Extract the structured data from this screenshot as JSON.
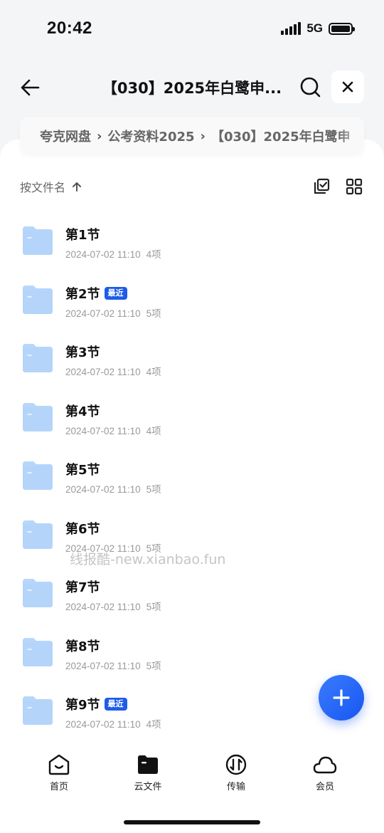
{
  "status_bar": {
    "time": "20:42",
    "network": "5G"
  },
  "nav": {
    "title": "【030】2025年白鹭申..."
  },
  "breadcrumb": {
    "items": [
      "夸克网盘",
      "公考资料2025",
      "【030】2025年白鹭申"
    ]
  },
  "sort": {
    "label": "按文件名"
  },
  "files": [
    {
      "name": "第1节",
      "date": "2024-07-02 11:10",
      "count": "4项",
      "badge": ""
    },
    {
      "name": "第2节",
      "date": "2024-07-02 11:10",
      "count": "5项",
      "badge": "最近"
    },
    {
      "name": "第3节",
      "date": "2024-07-02 11:10",
      "count": "4项",
      "badge": ""
    },
    {
      "name": "第4节",
      "date": "2024-07-02 11:10",
      "count": "4项",
      "badge": ""
    },
    {
      "name": "第5节",
      "date": "2024-07-02 11:10",
      "count": "5项",
      "badge": ""
    },
    {
      "name": "第6节",
      "date": "2024-07-02 11:10",
      "count": "5项",
      "badge": ""
    },
    {
      "name": "第7节",
      "date": "2024-07-02 11:10",
      "count": "5项",
      "badge": ""
    },
    {
      "name": "第8节",
      "date": "2024-07-02 11:10",
      "count": "5项",
      "badge": ""
    },
    {
      "name": "第9节",
      "date": "2024-07-02 11:10",
      "count": "4项",
      "badge": "最近"
    }
  ],
  "watermark": "线报酷-new.xianbao.fun",
  "tabs": [
    {
      "label": "首页",
      "icon": "home-icon"
    },
    {
      "label": "云文件",
      "icon": "folder-icon"
    },
    {
      "label": "传输",
      "icon": "transfer-icon"
    },
    {
      "label": "会员",
      "icon": "cloud-icon"
    }
  ],
  "colors": {
    "accent": "#1d5ce8",
    "folder": "#a9cdf9"
  }
}
